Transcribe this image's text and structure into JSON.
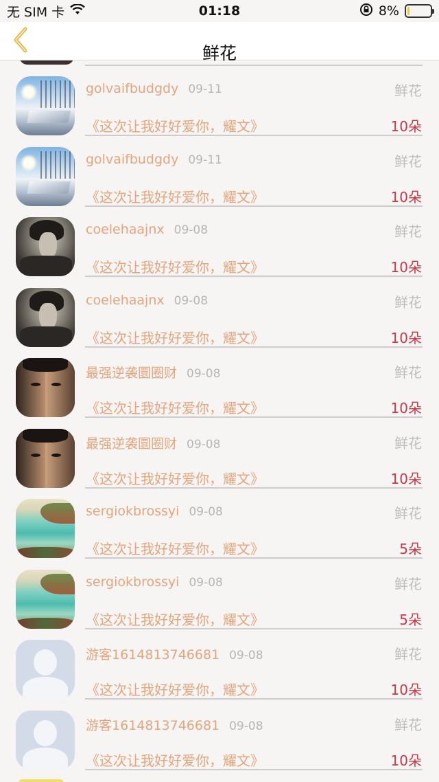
{
  "status_bar": {
    "carrier": "无 SIM 卡",
    "time": "01:18",
    "battery_percent": "8%",
    "battery_level": 0.08,
    "icons": [
      "wifi-icon",
      "rotation-lock-icon",
      "battery-icon"
    ]
  },
  "nav": {
    "title": "鲜花",
    "back_icon": "chevron-left-icon",
    "accent_color": "#e3b54a"
  },
  "items": [
    {
      "name": "golvaifbudgdy",
      "date": "09-11",
      "gift": "鲜花",
      "song": "《这次让我好好爱你，耀文》",
      "count": "10朵",
      "avatar": "snow-park"
    },
    {
      "name": "golvaifbudgdy",
      "date": "09-11",
      "gift": "鲜花",
      "song": "《这次让我好好爱你，耀文》",
      "count": "10朵",
      "avatar": "snow-park"
    },
    {
      "name": "coelehaajnx",
      "date": "09-08",
      "gift": "鲜花",
      "song": "《这次让我好好爱你，耀文》",
      "count": "10朵",
      "avatar": "anime-man"
    },
    {
      "name": "coelehaajnx",
      "date": "09-08",
      "gift": "鲜花",
      "song": "《这次让我好好爱你，耀文》",
      "count": "10朵",
      "avatar": "anime-man"
    },
    {
      "name": "最强逆袭圜圈财",
      "date": "09-08",
      "gift": "鲜花",
      "song": "《这次让我好好爱你，耀文》",
      "count": "10朵",
      "avatar": "split-face"
    },
    {
      "name": "最强逆袭圜圈财",
      "date": "09-08",
      "gift": "鲜花",
      "song": "《这次让我好好爱你，耀文》",
      "count": "10朵",
      "avatar": "split-face"
    },
    {
      "name": "sergiokbrossyi",
      "date": "09-08",
      "gift": "鲜花",
      "song": "《这次让我好好爱你，耀文》",
      "count": "5朵",
      "avatar": "beach"
    },
    {
      "name": "sergiokbrossyi",
      "date": "09-08",
      "gift": "鲜花",
      "song": "《这次让我好好爱你，耀文》",
      "count": "5朵",
      "avatar": "beach"
    },
    {
      "name": "游客1614813746681",
      "date": "09-08",
      "gift": "鲜花",
      "song": "《这次让我好好爱你，耀文》",
      "count": "10朵",
      "avatar": "default-user"
    },
    {
      "name": "游客1614813746681",
      "date": "09-08",
      "gift": "鲜花",
      "song": "《这次让我好好爱你，耀文》",
      "count": "10朵",
      "avatar": "default-user"
    }
  ],
  "colors": {
    "name_text": "#e3a57c",
    "date_text": "#b9b5b5",
    "gift_text": "#c0bcbc",
    "count_text": "#c8374a",
    "background": "#f7f4f4"
  }
}
